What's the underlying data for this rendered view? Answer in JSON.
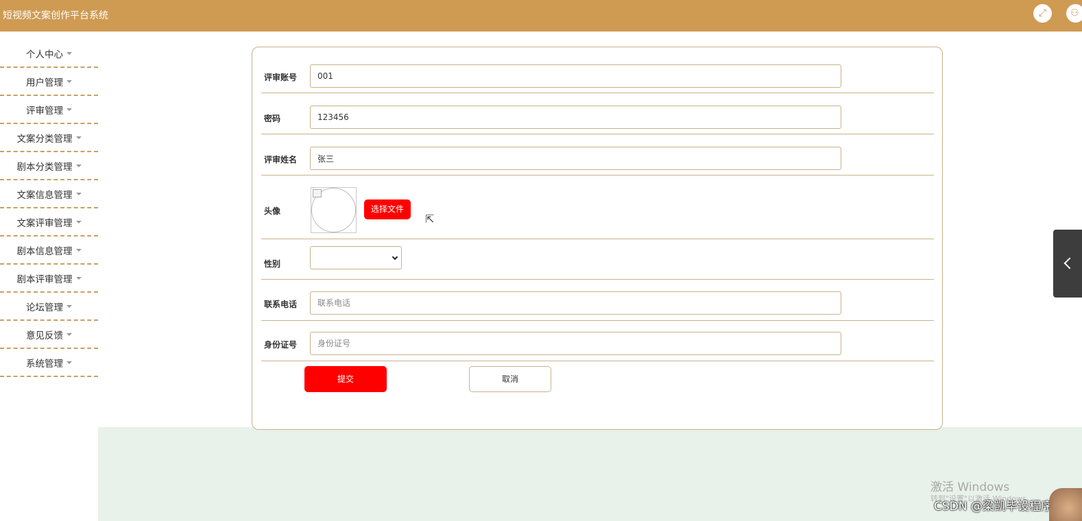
{
  "header": {
    "title": "短视频文案创作平台系统",
    "fullscreen_icon": "expand-icon",
    "user_icon": "user-icon"
  },
  "sidebar": {
    "items": [
      {
        "label": "个人中心"
      },
      {
        "label": "用户管理"
      },
      {
        "label": "评审管理"
      },
      {
        "label": "文案分类管理"
      },
      {
        "label": "剧本分类管理"
      },
      {
        "label": "文案信息管理"
      },
      {
        "label": "文案评审管理"
      },
      {
        "label": "剧本信息管理"
      },
      {
        "label": "剧本评审管理"
      },
      {
        "label": "论坛管理"
      },
      {
        "label": "意见反馈"
      },
      {
        "label": "系统管理"
      }
    ]
  },
  "form": {
    "account": {
      "label": "评审账号",
      "value": "001"
    },
    "password": {
      "label": "密码",
      "value": "123456"
    },
    "name": {
      "label": "评审姓名",
      "value": "张三"
    },
    "avatar": {
      "label": "头像",
      "button_label": "选择文件"
    },
    "gender": {
      "label": "性别",
      "value": ""
    },
    "phone": {
      "label": "联系电话",
      "value": "",
      "placeholder": "联系电话"
    },
    "id_card": {
      "label": "身份证号",
      "value": "",
      "placeholder": "身份证号"
    },
    "submit_label": "提交",
    "cancel_label": "取消"
  },
  "overlay": {
    "windows_activate": "激活 Windows",
    "windows_activate_sub": "转到\"设置\"以激活 Windows。",
    "watermark": "CSDN @梁凯毕设程序"
  },
  "colors": {
    "header": "#cf9a52",
    "accent_red": "#ff0000",
    "border": "#c8b28a",
    "footer_bg": "#e8f1ea"
  }
}
